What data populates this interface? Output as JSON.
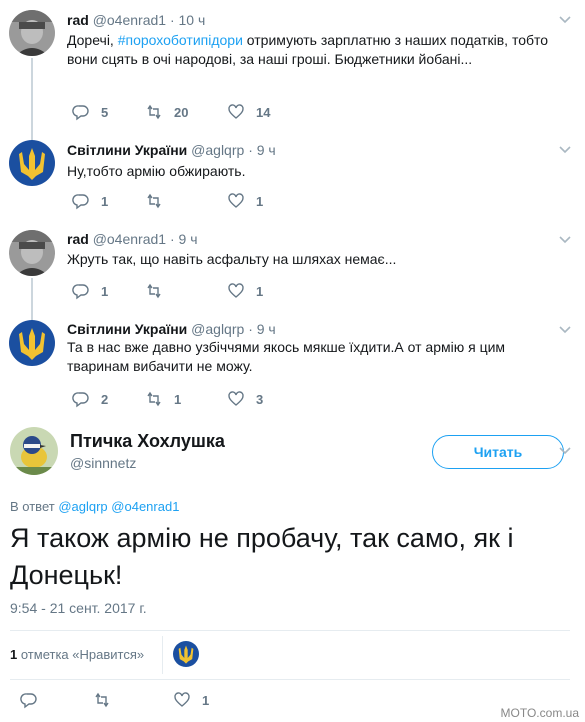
{
  "tweets": [
    {
      "name": "rad",
      "handle": "@o4enrad1",
      "time": "· 10 ч",
      "text_pre": "Доречі, ",
      "hashtag": "#порохоботипідори",
      "text_post": " отримують зарплатню з наших податків, тобто вони сцять в очі народові, за наші гроші. Бюджетники йобані...",
      "replies": "5",
      "retweets": "20",
      "likes": "14",
      "avatar": "person-photo"
    },
    {
      "name": "Світлини України",
      "handle": "@aglqrp",
      "time": "· 9 ч",
      "text": "Ну,тобто армію обжирають.",
      "replies": "1",
      "retweets": "",
      "likes": "1",
      "avatar": "trident-emblem"
    },
    {
      "name": "rad",
      "handle": "@o4enrad1",
      "time": "· 9 ч",
      "text": "Жруть так, що навіть асфальту на шляхах немає...",
      "replies": "1",
      "retweets": "",
      "likes": "1",
      "avatar": "person-photo"
    },
    {
      "name": "Світлини України",
      "handle": "@aglqrp",
      "time": "· 9 ч",
      "text": "Та в нас вже давно узбіччями якось мякше їхдити.А от армію я цим тваринам вибачити не можу.",
      "replies": "2",
      "retweets": "1",
      "likes": "3",
      "avatar": "trident-emblem"
    }
  ],
  "main": {
    "name": "Птичка Хохлушка",
    "handle": "@sinnnetz",
    "follow_label": "Читать",
    "reply_prefix": "В ответ",
    "reply_to_1": "@aglqrp",
    "reply_to_2": "@o4enrad1",
    "text": "Я також армію не пробачу, так само, як і Донецьк!",
    "timestamp": "9:54 - 21 сент. 2017 г.",
    "likes_count": "1",
    "likes_label": "отметка «Нравится»",
    "action_likes": "1",
    "avatar": "bird-photo"
  },
  "watermark": "MOTO.com.ua",
  "colors": {
    "accent": "#1da1f2",
    "muted": "#657786",
    "thread_line": "#ccd6dd",
    "trident_blue": "#1b4fa0",
    "trident_gold": "#f2c230"
  }
}
